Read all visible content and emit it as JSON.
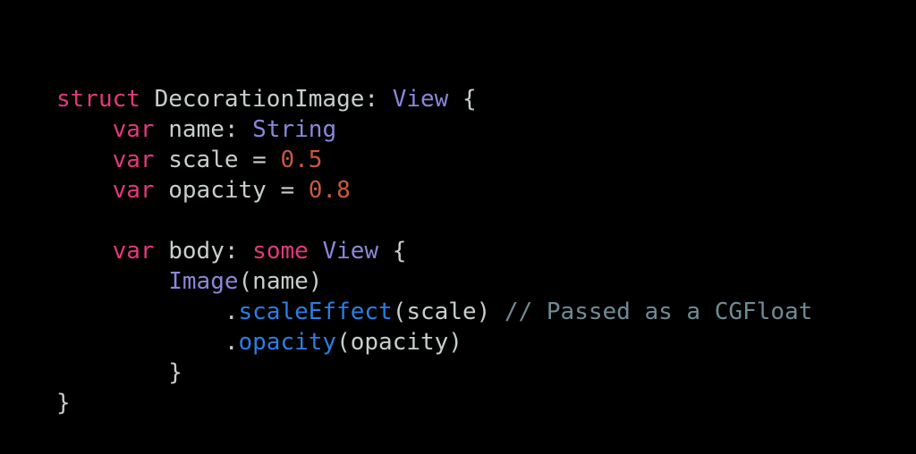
{
  "slide": {
    "background_color": "#000000",
    "language": "swift",
    "title_text": "",
    "font_size_px": 26,
    "line_height_px": 34
  },
  "palette": {
    "plain": "#c7cfcb",
    "keyword": "#e2397d",
    "type": "#8a87d8",
    "number": "#c8593c",
    "method": "#2b7ee3",
    "comment": "#6f8b95",
    "background": "#000000"
  },
  "code": {
    "lines": [
      {
        "index": 1,
        "text": "struct DecorationImage: View {",
        "tokens": [
          {
            "t": "struct",
            "k": "kw"
          },
          {
            "t": " DecorationImage: ",
            "k": "plain"
          },
          {
            "t": "View",
            "k": "type"
          },
          {
            "t": " {",
            "k": "punct"
          }
        ]
      },
      {
        "index": 2,
        "text": "    var name: String",
        "tokens": [
          {
            "t": "    ",
            "k": "plain"
          },
          {
            "t": "var",
            "k": "kw"
          },
          {
            "t": " name: ",
            "k": "plain"
          },
          {
            "t": "String",
            "k": "type"
          }
        ]
      },
      {
        "index": 3,
        "text": "    var scale = 0.5",
        "tokens": [
          {
            "t": "    ",
            "k": "plain"
          },
          {
            "t": "var",
            "k": "kw"
          },
          {
            "t": " scale = ",
            "k": "plain"
          },
          {
            "t": "0.5",
            "k": "num"
          }
        ]
      },
      {
        "index": 4,
        "text": "    var opacity = 0.8",
        "tokens": [
          {
            "t": "    ",
            "k": "plain"
          },
          {
            "t": "var",
            "k": "kw"
          },
          {
            "t": " opacity = ",
            "k": "plain"
          },
          {
            "t": "0.8",
            "k": "num"
          }
        ]
      },
      {
        "index": 5,
        "text": "",
        "tokens": []
      },
      {
        "index": 6,
        "text": "    var body: some View {",
        "tokens": [
          {
            "t": "    ",
            "k": "plain"
          },
          {
            "t": "var",
            "k": "kw"
          },
          {
            "t": " body: ",
            "k": "plain"
          },
          {
            "t": "some",
            "k": "kw"
          },
          {
            "t": " ",
            "k": "plain"
          },
          {
            "t": "View",
            "k": "type"
          },
          {
            "t": " {",
            "k": "punct"
          }
        ]
      },
      {
        "index": 7,
        "text": "        Image(name)",
        "tokens": [
          {
            "t": "        ",
            "k": "plain"
          },
          {
            "t": "Image",
            "k": "type"
          },
          {
            "t": "(name)",
            "k": "plain"
          }
        ]
      },
      {
        "index": 8,
        "text": "            .scaleEffect(scale) // Passed as a CGFloat",
        "tokens": [
          {
            "t": "            ",
            "k": "plain"
          },
          {
            "t": ".",
            "k": "punct"
          },
          {
            "t": "scaleEffect",
            "k": "method"
          },
          {
            "t": "(scale) ",
            "k": "plain"
          },
          {
            "t": "// Passed as a CGFloat",
            "k": "comment"
          }
        ]
      },
      {
        "index": 9,
        "text": "            .opacity(opacity)",
        "tokens": [
          {
            "t": "            ",
            "k": "plain"
          },
          {
            "t": ".",
            "k": "punct"
          },
          {
            "t": "opacity",
            "k": "method"
          },
          {
            "t": "(opacity)",
            "k": "plain"
          }
        ]
      },
      {
        "index": 10,
        "text": "        }",
        "tokens": [
          {
            "t": "        ",
            "k": "plain"
          },
          {
            "t": "}",
            "k": "punct"
          }
        ]
      },
      {
        "index": 11,
        "text": "}",
        "tokens": [
          {
            "t": "}",
            "k": "punct"
          }
        ]
      }
    ]
  }
}
